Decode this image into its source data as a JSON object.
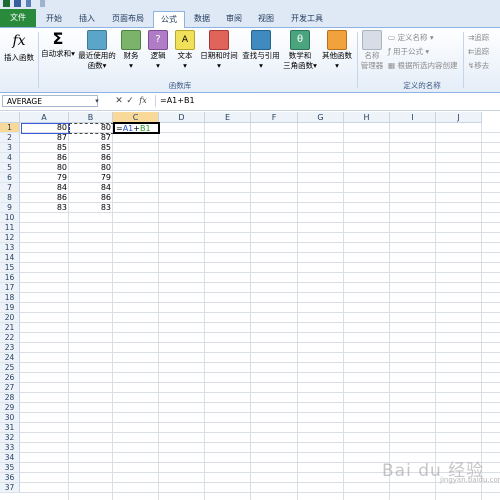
{
  "ribbon_tabs": {
    "file": "文件",
    "home": "开始",
    "insert": "插入",
    "page_layout": "页面布局",
    "formulas": "公式",
    "data": "数据",
    "review": "审阅",
    "view": "视图",
    "developer": "开发工具"
  },
  "ribbon": {
    "insert_function": "插入函数",
    "autosum": "自动求和",
    "recent_line1": "最近使用的",
    "recent_line2": "函数",
    "financial": "财务",
    "logical": "逻辑",
    "text": "文本",
    "date_time": "日期和时间",
    "lookup": "查找与引用",
    "math_line1": "数学和",
    "math_line2": "三角函数",
    "more_functions": "其他函数",
    "function_library_label": "函数库",
    "name_manager_line1": "名称",
    "name_manager_line2": "管理器",
    "define_name": "定义名称",
    "use_in_formula": "用于公式",
    "create_from_selection": "根据所选内容创建",
    "defined_names_label": "定义的名称",
    "trace_precedents": "追踪",
    "trace_dependents": "追踪",
    "remove_arrows": "移去",
    "dropdown_arrow": "▾"
  },
  "formula_bar": {
    "name_box": "AVERAGE",
    "cancel": "✕",
    "enter": "✓",
    "fx": "fx",
    "formula": "=A1+B1"
  },
  "columns": [
    "A",
    "B",
    "C",
    "D",
    "E",
    "F",
    "G",
    "H",
    "I",
    "J"
  ],
  "rows": [
    "1",
    "2",
    "3",
    "4",
    "5",
    "6",
    "7",
    "8",
    "9",
    "10",
    "11",
    "12",
    "13",
    "14",
    "15",
    "16",
    "17",
    "18",
    "19",
    "20",
    "21",
    "22",
    "23",
    "24",
    "25",
    "26",
    "27",
    "28",
    "29",
    "30",
    "31",
    "32",
    "33",
    "34",
    "35",
    "36",
    "37"
  ],
  "cells": {
    "A": [
      "80",
      "87",
      "85",
      "86",
      "80",
      "79",
      "84",
      "86",
      "83"
    ],
    "B": [
      "80",
      "87",
      "85",
      "86",
      "80",
      "79",
      "84",
      "86",
      "83"
    ]
  },
  "editing_cell": {
    "eq": "=",
    "ref_a": "A1",
    "plus": "+",
    "ref_b": "B1"
  },
  "watermark": {
    "text": "Bai du 经验",
    "sub": "jingyan.baidu.com"
  },
  "colors": {
    "file_tab": "#2a8a3c",
    "selected_header": "#f9d99a",
    "ref_a": "#1f4fd1",
    "ref_b": "#2b9a2b"
  }
}
